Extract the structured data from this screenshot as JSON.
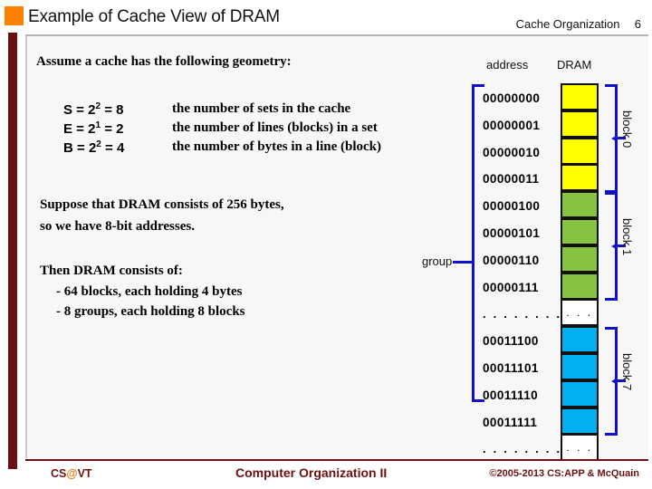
{
  "header": {
    "title": "Example of Cache View of DRAM",
    "topic": "Cache Organization",
    "slide_number": "6"
  },
  "content": {
    "lead": "Assume a cache has the following geometry:",
    "geometry": [
      {
        "symbol": "S",
        "base": "2",
        "exponent": "2",
        "value": "8",
        "description": "the number of sets in the cache"
      },
      {
        "symbol": "E",
        "base": "2",
        "exponent": "1",
        "value": "2",
        "description": "the number of lines (blocks) in a set"
      },
      {
        "symbol": "B",
        "base": "2",
        "exponent": "2",
        "value": "4",
        "description": "the number of bytes in a line (block)"
      }
    ],
    "paragraph1_line1": "Suppose that DRAM consists of 256 bytes,",
    "paragraph1_line2": "so we have 8-bit addresses.",
    "paragraph2_line1": "Then DRAM consists of:",
    "bullet1": "-   64 blocks, each holding 4 bytes",
    "bullet2": "-   8 groups, each holding 8 blocks"
  },
  "diagram": {
    "address_header": "address",
    "dram_header": "DRAM",
    "group_label": "group",
    "block_labels": [
      "block 0",
      "block 1",
      "block 7"
    ],
    "colors": {
      "block0": "#ffff00",
      "block1": "#86c440",
      "block7": "#00b0f0",
      "bracket": "#1111cc"
    },
    "rows": [
      {
        "address": "00000000",
        "color": "yellow"
      },
      {
        "address": "00000001",
        "color": "yellow"
      },
      {
        "address": "00000010",
        "color": "yellow"
      },
      {
        "address": "00000011",
        "color": "yellow"
      },
      {
        "address": "00000100",
        "color": "green"
      },
      {
        "address": "00000101",
        "color": "green"
      },
      {
        "address": "00000110",
        "color": "green"
      },
      {
        "address": "00000111",
        "color": "green"
      },
      {
        "address": ". . . . . . . .",
        "color": "blank",
        "cell_text": ". . ."
      },
      {
        "address": "00011100",
        "color": "blue"
      },
      {
        "address": "00011101",
        "color": "blue"
      },
      {
        "address": "00011110",
        "color": "blue"
      },
      {
        "address": "00011111",
        "color": "blue"
      },
      {
        "address": ". . . . . . . .",
        "color": "blank",
        "cell_text": ". . ."
      }
    ]
  },
  "footer": {
    "left_prefix": "CS",
    "left_at": "@",
    "left_suffix": "VT",
    "center": "Computer Organization II",
    "right": "©2005-2013 CS:APP & McQuain"
  }
}
